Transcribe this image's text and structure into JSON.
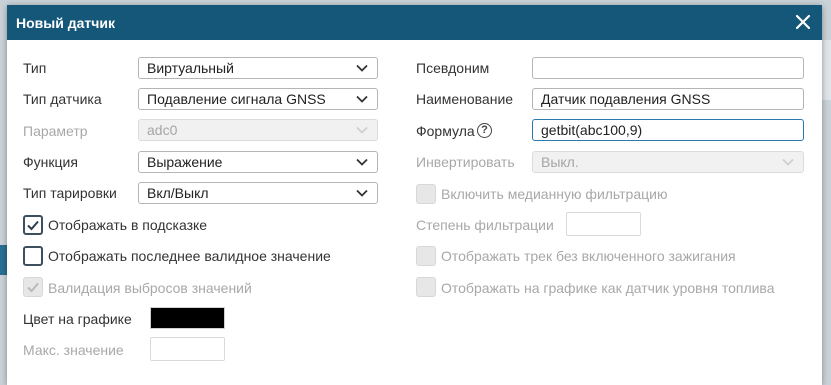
{
  "dialog": {
    "title": "Новый датчик"
  },
  "left": {
    "type": {
      "label": "Тип",
      "value": "Виртуальный"
    },
    "sensor_type": {
      "label": "Тип датчика",
      "value": "Подавление сигнала GNSS"
    },
    "parameter": {
      "label": "Параметр",
      "value": "adc0"
    },
    "function": {
      "label": "Функция",
      "value": "Выражение"
    },
    "calibration_type": {
      "label": "Тип тарировки",
      "value": "Вкл/Выкл"
    },
    "show_in_tooltip": {
      "label": "Отображать в подсказке",
      "checked": true
    },
    "show_last_valid": {
      "label": "Отображать последнее валидное значение",
      "checked": false
    },
    "outlier_validation": {
      "label": "Валидация выбросов значений",
      "checked": true,
      "disabled": true
    },
    "chart_color": {
      "label": "Цвет на графике",
      "color": "#000000"
    },
    "max_value": {
      "label": "Макс. значение",
      "value": ""
    }
  },
  "right": {
    "alias": {
      "label": "Псевдоним",
      "value": ""
    },
    "name": {
      "label": "Наименование",
      "value": "Датчик подавления GNSS"
    },
    "formula": {
      "label": "Формула",
      "value": "getbit(abc100,9)",
      "help": "?"
    },
    "invert": {
      "label": "Инвертировать",
      "value": "Выкл."
    },
    "median_filter": {
      "label": "Включить медианную фильтрацию",
      "checked": false
    },
    "filter_degree": {
      "label": "Степень фильтрации",
      "value": ""
    },
    "track_no_ignition": {
      "label": "Отображать трек без включенного зажигания",
      "checked": false
    },
    "show_as_fuel": {
      "label": "Отображать на графике как датчик уровня топлива",
      "checked": false
    }
  },
  "colors": {
    "titlebar": "#145778",
    "checkbox_border": "#3d4f5e",
    "focus_border": "#2a7ab0"
  }
}
